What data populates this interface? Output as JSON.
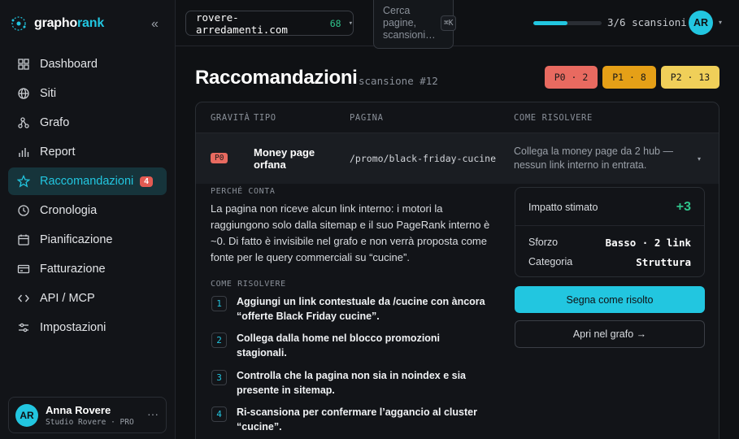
{
  "brand": {
    "name_part1": "grapho",
    "name_part2": "rank",
    "collapse_glyph": "«",
    "accent": "#22c6e0"
  },
  "sidebar": {
    "items": [
      {
        "label": "Dashboard",
        "icon": "grid-icon"
      },
      {
        "label": "Siti",
        "icon": "globe-icon"
      },
      {
        "label": "Grafo",
        "icon": "graph-icon"
      },
      {
        "label": "Report",
        "icon": "bar-chart-icon"
      },
      {
        "label": "Raccomandazioni",
        "icon": "star-icon",
        "badge": "4",
        "active": true
      },
      {
        "label": "Cronologia",
        "icon": "clock-icon"
      },
      {
        "label": "Pianificazione",
        "icon": "calendar-icon"
      },
      {
        "label": "Fatturazione",
        "icon": "credit-card-icon"
      },
      {
        "label": "API / MCP",
        "icon": "code-icon"
      },
      {
        "label": "Impostazioni",
        "icon": "sliders-icon"
      }
    ],
    "user": {
      "initials": "AR",
      "name": "Anna Rovere",
      "subtitle": "Studio Rovere · PRO",
      "more": "···"
    }
  },
  "topbar": {
    "site": "rovere-arredamenti.com",
    "site_count": "68",
    "search_placeholder": "Cerca pagine, scansioni…",
    "search_shortcut": "⌘K",
    "scan_progress": 0.5,
    "scan_text": "3/6 scansioni",
    "avatar": "AR"
  },
  "page": {
    "title": "Raccomandazioni",
    "subtitle": "scansione #12",
    "priorities": [
      {
        "label": "P0 · 2",
        "color": "#e86a60"
      },
      {
        "label": "P1 · 8",
        "color": "#e5a017"
      },
      {
        "label": "P2 · 13",
        "color": "#f0cf59"
      }
    ]
  },
  "table": {
    "headers": {
      "gravita": "GRAVITÀ",
      "tipo": "TIPO",
      "pagina": "PAGINA",
      "come": "COME RISOLVERE"
    },
    "row": {
      "priority": "P0",
      "type": "Money page orfana",
      "page": "/promo/black-friday-cucine",
      "fix": "Collega la money page da 2 hub — nessun link interno in entrata."
    }
  },
  "detail": {
    "why_label": "PERCHÉ CONTA",
    "why_text": "La pagina non riceve alcun link interno: i motori la raggiungono solo dalla sitemap e il suo PageRank interno è ~0. Di fatto è invisibile nel grafo e non verrà proposta come fonte per le query commerciali su “cucine”.",
    "how_label": "COME RISOLVERE",
    "steps": [
      {
        "num": "1",
        "text": "Aggiungi un link contestuale da /cucine con àncora “offerte Black Friday cucine”."
      },
      {
        "num": "2",
        "text": "Collega dalla home nel blocco promozioni stagionali."
      },
      {
        "num": "3",
        "text": "Controlla che la pagina non sia in noindex e sia presente in sitemap."
      },
      {
        "num": "4",
        "text": "Ri-scansiona per confermare l’aggancio al cluster “cucine”."
      }
    ],
    "impact": {
      "label": "Impatto stimato",
      "value": "+3",
      "effort_label": "Sforzo",
      "effort_value": "Basso · 2 link",
      "category_label": "Categoria",
      "category_value": "Struttura"
    },
    "primary_button": "Segna come risolto",
    "secondary_button": "Apri nel grafo →"
  }
}
